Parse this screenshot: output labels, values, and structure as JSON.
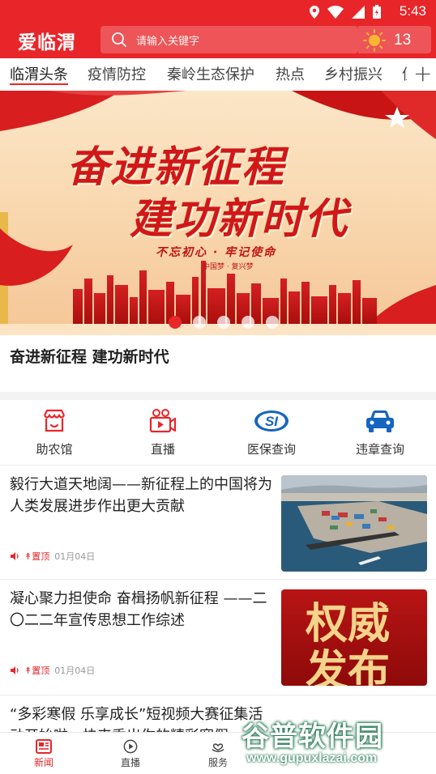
{
  "status_bar": {
    "time": "5:43"
  },
  "header": {
    "logo": "爱临渭",
    "search_placeholder": "请输入关键字",
    "temperature": "13"
  },
  "tabs": [
    "临渭头条",
    "疫情防控",
    "秦岭生态保护",
    "热点",
    "乡村振兴",
    "值"
  ],
  "banner": {
    "line1": "奋进新征程",
    "line2": "建功新时代",
    "sub": "不忘初心 · 牢记使命",
    "sub2": "中国梦 · 复兴梦",
    "slide_count": 5,
    "active_slide": 0
  },
  "caption": "奋进新征程  建功新时代",
  "quick_links": [
    {
      "label": "助农馆",
      "icon": "shop-icon"
    },
    {
      "label": "直播",
      "icon": "video-camera-icon"
    },
    {
      "label": "医保查询",
      "icon": "si-logo-icon"
    },
    {
      "label": "违章查询",
      "icon": "car-icon"
    }
  ],
  "news": [
    {
      "title": "毅行大道天地阔——新征程上的中国将为人类发展进步作出更大贡献",
      "tag": "置顶",
      "date": "01月04日",
      "thumb": "port-photo"
    },
    {
      "title": "凝心聚力担使命 奋楫扬帆新征程 ——二〇二二年宣传思想工作综述",
      "tag": "置顶",
      "date": "01月04日",
      "thumb": "authority-release",
      "thumb_text1": "权威",
      "thumb_text2": "发布"
    },
    {
      "title": "“多彩寒假 乐享成长”短视频大赛征集活动开始啦，快来秀出你的精彩寒假"
    }
  ],
  "bottom_nav": [
    {
      "label": "新闻",
      "active": true
    },
    {
      "label": "直播",
      "active": false
    },
    {
      "label": "服务",
      "active": false
    }
  ],
  "watermark": {
    "main": "谷普软件园",
    "url": "www.gupuxlazai.com"
  },
  "colors": {
    "brand_red": "#e8262a"
  }
}
